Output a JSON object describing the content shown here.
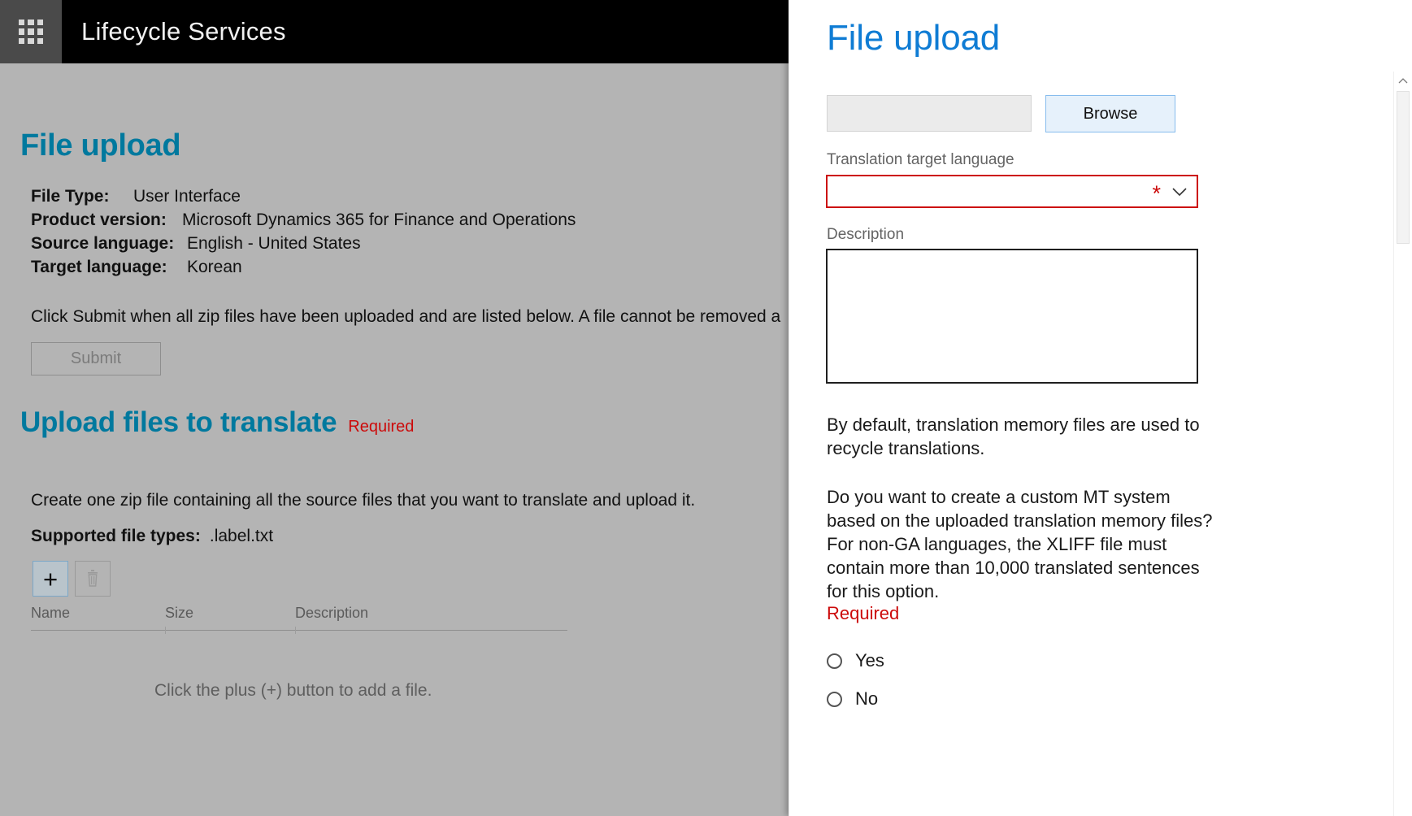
{
  "colors": {
    "brand_teal": "#00799e",
    "panel_title_blue": "#0f7cd4",
    "required_red": "#cc0a0a",
    "page_background": "#b4b4b4",
    "topbar_black": "#000000",
    "waffle_button": "#4a4a4a"
  },
  "topbar": {
    "waffle_icon": "waffle-grid-icon",
    "app_title": "Lifecycle Services"
  },
  "main": {
    "page_title": "File upload",
    "metadata": [
      {
        "label": "File Type:",
        "value": "User Interface"
      },
      {
        "label": "Product version:",
        "value": "Microsoft Dynamics 365 for Finance and Operations"
      },
      {
        "label": "Source language:",
        "value": "English - United States"
      },
      {
        "label": "Target language:",
        "value": "Korean"
      }
    ],
    "submit_instructions": "Click Submit when all zip files have been uploaded and are listed below. A file cannot be removed a",
    "submit_label": "Submit",
    "section_title": "Upload files to translate",
    "section_required": "Required",
    "create_zip_text": "Create one zip file containing all the source files that you want to translate and upload it.",
    "supported_label": "Supported file types:",
    "supported_value": ".label.txt",
    "toolbar": {
      "add_icon": "plus-icon",
      "add_glyph": "+",
      "delete_icon": "trash-icon"
    },
    "grid": {
      "columns": [
        "Name",
        "Size",
        "Description"
      ],
      "rows": [],
      "empty_message": "Click the plus (+) button to add a file."
    }
  },
  "panel": {
    "title": "File upload",
    "file_path_value": "",
    "file_path_placeholder": "",
    "browse_label": "Browse",
    "target_language": {
      "label": "Translation target language",
      "selected_value": "",
      "required_marker": "*",
      "chevron_icon": "chevron-down-icon",
      "options": []
    },
    "description": {
      "label": "Description",
      "value": "",
      "placeholder": ""
    },
    "paragraph_tm": "By default, translation memory files are used to recycle translations.",
    "paragraph_mt": "Do you want to create a custom MT system based on the uploaded translation memory files? For non-GA languages, the XLIFF file must contain more than 10,000 translated sentences for this option.",
    "required_text": "Required",
    "radios": [
      {
        "label": "Yes",
        "selected": false
      },
      {
        "label": "No",
        "selected": false
      }
    ],
    "scrollbar": {
      "up_arrow_icon": "chevron-up-icon"
    }
  }
}
